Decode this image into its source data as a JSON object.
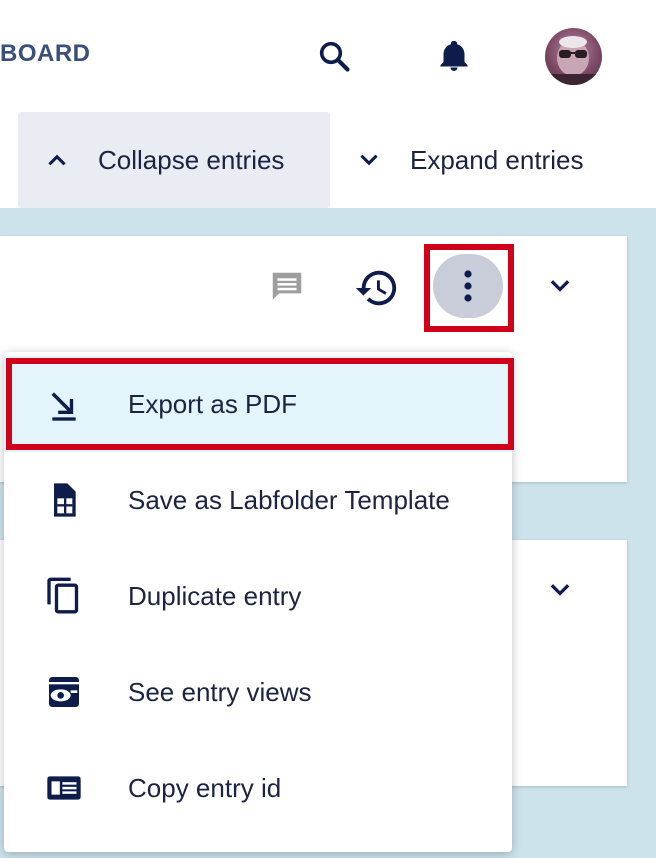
{
  "header": {
    "brand": "BOARD",
    "search_icon": "search-icon",
    "notifications_icon": "bell-icon",
    "avatar": "user-avatar"
  },
  "entry_toggles": {
    "collapse_label": "Collapse entries",
    "expand_label": "Expand entries"
  },
  "entry_toolbar": {
    "comment_icon": "comment-icon",
    "history_icon": "history-icon",
    "more_icon": "more-vertical-icon",
    "expand_icon": "chevron-down-icon"
  },
  "menu": {
    "items": [
      {
        "label": "Export as PDF",
        "icon": "export-pdf-icon",
        "selected": true
      },
      {
        "label": "Save as Labfolder Template",
        "icon": "template-icon"
      },
      {
        "label": "Duplicate entry",
        "icon": "duplicate-icon"
      },
      {
        "label": "See entry views",
        "icon": "views-icon"
      },
      {
        "label": "Copy entry id",
        "icon": "id-card-icon"
      }
    ]
  },
  "colors": {
    "accent_text": "#1c2340",
    "brand": "#3a4f7a",
    "highlight": "#d0021b",
    "canvas": "#cde3ec",
    "selected_row": "#e3f4fb"
  }
}
